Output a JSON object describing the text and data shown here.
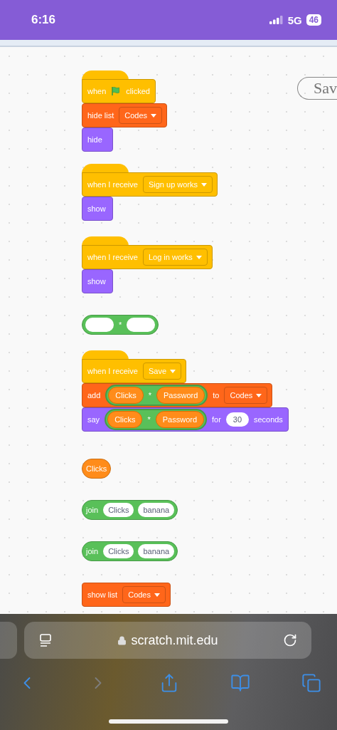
{
  "status_bar": {
    "time": "6:16",
    "network": "5G",
    "battery": "46"
  },
  "canvas": {
    "save_label": "Sav",
    "scripts": [
      {
        "blocks": [
          {
            "kind": "hat",
            "color": "#ffbf00",
            "parts": [
              {
                "kind": "text",
                "text": "when"
              },
              {
                "kind": "flag"
              },
              {
                "kind": "text",
                "text": "clicked"
              }
            ]
          },
          {
            "kind": "stack",
            "color": "#ff661a",
            "parts": [
              {
                "kind": "text",
                "text": "hide list"
              },
              {
                "kind": "dropdown",
                "text": "Codes"
              }
            ]
          },
          {
            "kind": "stack",
            "color": "#9966ff",
            "parts": [
              {
                "kind": "text",
                "text": "hide"
              }
            ]
          }
        ]
      },
      {
        "blocks": [
          {
            "kind": "hat",
            "color": "#ffbf00",
            "parts": [
              {
                "kind": "text",
                "text": "when I receive"
              },
              {
                "kind": "dropdown",
                "text": "Sign up works"
              }
            ]
          },
          {
            "kind": "stack",
            "color": "#9966ff",
            "parts": [
              {
                "kind": "text",
                "text": "show"
              }
            ]
          }
        ]
      },
      {
        "blocks": [
          {
            "kind": "hat",
            "color": "#ffbf00",
            "parts": [
              {
                "kind": "text",
                "text": "when I receive"
              },
              {
                "kind": "dropdown",
                "text": "Log in works"
              }
            ]
          },
          {
            "kind": "stack",
            "color": "#9966ff",
            "parts": [
              {
                "kind": "text",
                "text": "show"
              }
            ]
          }
        ]
      },
      {
        "blocks": [
          {
            "kind": "reporter",
            "color": "#59c059",
            "parts": [
              {
                "kind": "input"
              },
              {
                "kind": "text",
                "text": "*"
              },
              {
                "kind": "input"
              }
            ]
          }
        ]
      },
      {
        "blocks": [
          {
            "kind": "hat",
            "color": "#ffbf00",
            "parts": [
              {
                "kind": "text",
                "text": "when I receive"
              },
              {
                "kind": "dropdown",
                "text": "Save"
              }
            ]
          },
          {
            "kind": "stack",
            "color": "#ff661a",
            "parts": [
              {
                "kind": "text",
                "text": "add"
              },
              {
                "kind": "nested",
                "color": "#59c059",
                "parts": [
                  {
                    "kind": "variable",
                    "text": "Clicks"
                  },
                  {
                    "kind": "text",
                    "text": "*"
                  },
                  {
                    "kind": "variable",
                    "text": "Password"
                  }
                ]
              },
              {
                "kind": "text",
                "text": "to"
              },
              {
                "kind": "dropdown",
                "text": "Codes"
              }
            ]
          },
          {
            "kind": "stack",
            "color": "#9966ff",
            "parts": [
              {
                "kind": "text",
                "text": "say"
              },
              {
                "kind": "nested",
                "color": "#59c059",
                "parts": [
                  {
                    "kind": "variable",
                    "text": "Clicks"
                  },
                  {
                    "kind": "text",
                    "text": "*"
                  },
                  {
                    "kind": "variable",
                    "text": "Password"
                  }
                ]
              },
              {
                "kind": "text",
                "text": "for"
              },
              {
                "kind": "input",
                "text": "30"
              },
              {
                "kind": "text",
                "text": "seconds"
              }
            ]
          }
        ]
      },
      {
        "blocks": [
          {
            "kind": "reporter",
            "color": "#ff8c1a",
            "parts": [
              {
                "kind": "text",
                "text": "Clicks"
              }
            ]
          }
        ]
      },
      {
        "blocks": [
          {
            "kind": "reporter",
            "color": "#59c059",
            "parts": [
              {
                "kind": "text",
                "text": "join"
              },
              {
                "kind": "input",
                "text": "Clicks"
              },
              {
                "kind": "input",
                "text": "banana"
              }
            ]
          }
        ]
      },
      {
        "blocks": [
          {
            "kind": "reporter",
            "color": "#59c059",
            "parts": [
              {
                "kind": "text",
                "text": "join"
              },
              {
                "kind": "input",
                "text": "Clicks"
              },
              {
                "kind": "input",
                "text": "banana"
              }
            ]
          }
        ]
      },
      {
        "blocks": [
          {
            "kind": "stack",
            "color": "#ff661a",
            "parts": [
              {
                "kind": "text",
                "text": "show list"
              },
              {
                "kind": "dropdown",
                "text": "Codes"
              }
            ]
          }
        ]
      }
    ]
  },
  "browser": {
    "url": "scratch.mit.edu",
    "toolbar": [
      {
        "kind": "back",
        "disabled": false
      },
      {
        "kind": "forward",
        "disabled": true
      },
      {
        "kind": "share",
        "disabled": false
      },
      {
        "kind": "bookmarks",
        "disabled": false
      },
      {
        "kind": "tabs",
        "disabled": false
      }
    ]
  }
}
